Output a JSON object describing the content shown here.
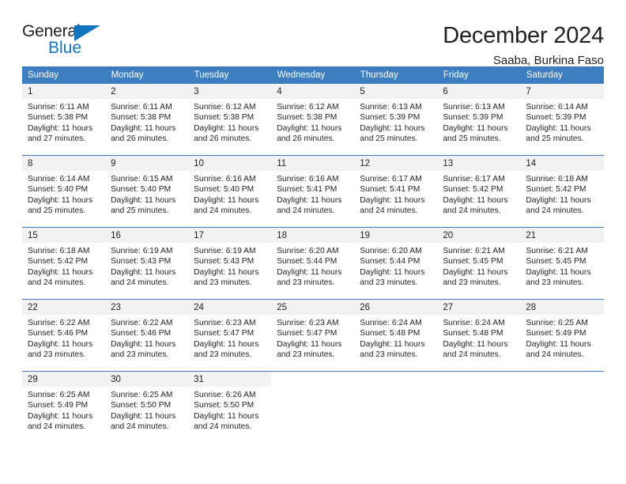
{
  "logo": {
    "word_top": "General",
    "word_bottom": "Blue",
    "triangle_color": "#1274bc",
    "blue_color": "#1274bc"
  },
  "header": {
    "title": "December 2024",
    "location": "Saaba, Burkina Faso"
  },
  "theme": {
    "header_blue": "#3c7ebf",
    "daynum_band": "#f2f2f2",
    "text": "#231f20"
  },
  "calendar": {
    "weekday_headers": [
      "Sunday",
      "Monday",
      "Tuesday",
      "Wednesday",
      "Thursday",
      "Friday",
      "Saturday"
    ],
    "labels": {
      "sunrise_prefix": "Sunrise:",
      "sunset_prefix": "Sunset:",
      "daylight_prefix": "Daylight:"
    },
    "weeks": [
      [
        {
          "day": "1",
          "sunrise": "Sunrise: 6:11 AM",
          "sunset": "Sunset: 5:38 PM",
          "daylight_line1": "Daylight: 11 hours",
          "daylight_line2": "and 27 minutes."
        },
        {
          "day": "2",
          "sunrise": "Sunrise: 6:11 AM",
          "sunset": "Sunset: 5:38 PM",
          "daylight_line1": "Daylight: 11 hours",
          "daylight_line2": "and 26 minutes."
        },
        {
          "day": "3",
          "sunrise": "Sunrise: 6:12 AM",
          "sunset": "Sunset: 5:38 PM",
          "daylight_line1": "Daylight: 11 hours",
          "daylight_line2": "and 26 minutes."
        },
        {
          "day": "4",
          "sunrise": "Sunrise: 6:12 AM",
          "sunset": "Sunset: 5:38 PM",
          "daylight_line1": "Daylight: 11 hours",
          "daylight_line2": "and 26 minutes."
        },
        {
          "day": "5",
          "sunrise": "Sunrise: 6:13 AM",
          "sunset": "Sunset: 5:39 PM",
          "daylight_line1": "Daylight: 11 hours",
          "daylight_line2": "and 25 minutes."
        },
        {
          "day": "6",
          "sunrise": "Sunrise: 6:13 AM",
          "sunset": "Sunset: 5:39 PM",
          "daylight_line1": "Daylight: 11 hours",
          "daylight_line2": "and 25 minutes."
        },
        {
          "day": "7",
          "sunrise": "Sunrise: 6:14 AM",
          "sunset": "Sunset: 5:39 PM",
          "daylight_line1": "Daylight: 11 hours",
          "daylight_line2": "and 25 minutes."
        }
      ],
      [
        {
          "day": "8",
          "sunrise": "Sunrise: 6:14 AM",
          "sunset": "Sunset: 5:40 PM",
          "daylight_line1": "Daylight: 11 hours",
          "daylight_line2": "and 25 minutes."
        },
        {
          "day": "9",
          "sunrise": "Sunrise: 6:15 AM",
          "sunset": "Sunset: 5:40 PM",
          "daylight_line1": "Daylight: 11 hours",
          "daylight_line2": "and 25 minutes."
        },
        {
          "day": "10",
          "sunrise": "Sunrise: 6:16 AM",
          "sunset": "Sunset: 5:40 PM",
          "daylight_line1": "Daylight: 11 hours",
          "daylight_line2": "and 24 minutes."
        },
        {
          "day": "11",
          "sunrise": "Sunrise: 6:16 AM",
          "sunset": "Sunset: 5:41 PM",
          "daylight_line1": "Daylight: 11 hours",
          "daylight_line2": "and 24 minutes."
        },
        {
          "day": "12",
          "sunrise": "Sunrise: 6:17 AM",
          "sunset": "Sunset: 5:41 PM",
          "daylight_line1": "Daylight: 11 hours",
          "daylight_line2": "and 24 minutes."
        },
        {
          "day": "13",
          "sunrise": "Sunrise: 6:17 AM",
          "sunset": "Sunset: 5:42 PM",
          "daylight_line1": "Daylight: 11 hours",
          "daylight_line2": "and 24 minutes."
        },
        {
          "day": "14",
          "sunrise": "Sunrise: 6:18 AM",
          "sunset": "Sunset: 5:42 PM",
          "daylight_line1": "Daylight: 11 hours",
          "daylight_line2": "and 24 minutes."
        }
      ],
      [
        {
          "day": "15",
          "sunrise": "Sunrise: 6:18 AM",
          "sunset": "Sunset: 5:42 PM",
          "daylight_line1": "Daylight: 11 hours",
          "daylight_line2": "and 24 minutes."
        },
        {
          "day": "16",
          "sunrise": "Sunrise: 6:19 AM",
          "sunset": "Sunset: 5:43 PM",
          "daylight_line1": "Daylight: 11 hours",
          "daylight_line2": "and 24 minutes."
        },
        {
          "day": "17",
          "sunrise": "Sunrise: 6:19 AM",
          "sunset": "Sunset: 5:43 PM",
          "daylight_line1": "Daylight: 11 hours",
          "daylight_line2": "and 23 minutes."
        },
        {
          "day": "18",
          "sunrise": "Sunrise: 6:20 AM",
          "sunset": "Sunset: 5:44 PM",
          "daylight_line1": "Daylight: 11 hours",
          "daylight_line2": "and 23 minutes."
        },
        {
          "day": "19",
          "sunrise": "Sunrise: 6:20 AM",
          "sunset": "Sunset: 5:44 PM",
          "daylight_line1": "Daylight: 11 hours",
          "daylight_line2": "and 23 minutes."
        },
        {
          "day": "20",
          "sunrise": "Sunrise: 6:21 AM",
          "sunset": "Sunset: 5:45 PM",
          "daylight_line1": "Daylight: 11 hours",
          "daylight_line2": "and 23 minutes."
        },
        {
          "day": "21",
          "sunrise": "Sunrise: 6:21 AM",
          "sunset": "Sunset: 5:45 PM",
          "daylight_line1": "Daylight: 11 hours",
          "daylight_line2": "and 23 minutes."
        }
      ],
      [
        {
          "day": "22",
          "sunrise": "Sunrise: 6:22 AM",
          "sunset": "Sunset: 5:46 PM",
          "daylight_line1": "Daylight: 11 hours",
          "daylight_line2": "and 23 minutes."
        },
        {
          "day": "23",
          "sunrise": "Sunrise: 6:22 AM",
          "sunset": "Sunset: 5:46 PM",
          "daylight_line1": "Daylight: 11 hours",
          "daylight_line2": "and 23 minutes."
        },
        {
          "day": "24",
          "sunrise": "Sunrise: 6:23 AM",
          "sunset": "Sunset: 5:47 PM",
          "daylight_line1": "Daylight: 11 hours",
          "daylight_line2": "and 23 minutes."
        },
        {
          "day": "25",
          "sunrise": "Sunrise: 6:23 AM",
          "sunset": "Sunset: 5:47 PM",
          "daylight_line1": "Daylight: 11 hours",
          "daylight_line2": "and 23 minutes."
        },
        {
          "day": "26",
          "sunrise": "Sunrise: 6:24 AM",
          "sunset": "Sunset: 5:48 PM",
          "daylight_line1": "Daylight: 11 hours",
          "daylight_line2": "and 23 minutes."
        },
        {
          "day": "27",
          "sunrise": "Sunrise: 6:24 AM",
          "sunset": "Sunset: 5:48 PM",
          "daylight_line1": "Daylight: 11 hours",
          "daylight_line2": "and 24 minutes."
        },
        {
          "day": "28",
          "sunrise": "Sunrise: 6:25 AM",
          "sunset": "Sunset: 5:49 PM",
          "daylight_line1": "Daylight: 11 hours",
          "daylight_line2": "and 24 minutes."
        }
      ],
      [
        {
          "day": "29",
          "sunrise": "Sunrise: 6:25 AM",
          "sunset": "Sunset: 5:49 PM",
          "daylight_line1": "Daylight: 11 hours",
          "daylight_line2": "and 24 minutes."
        },
        {
          "day": "30",
          "sunrise": "Sunrise: 6:25 AM",
          "sunset": "Sunset: 5:50 PM",
          "daylight_line1": "Daylight: 11 hours",
          "daylight_line2": "and 24 minutes."
        },
        {
          "day": "31",
          "sunrise": "Sunrise: 6:26 AM",
          "sunset": "Sunset: 5:50 PM",
          "daylight_line1": "Daylight: 11 hours",
          "daylight_line2": "and 24 minutes."
        },
        {
          "day": "",
          "sunrise": "",
          "sunset": "",
          "daylight_line1": "",
          "daylight_line2": ""
        },
        {
          "day": "",
          "sunrise": "",
          "sunset": "",
          "daylight_line1": "",
          "daylight_line2": ""
        },
        {
          "day": "",
          "sunrise": "",
          "sunset": "",
          "daylight_line1": "",
          "daylight_line2": ""
        },
        {
          "day": "",
          "sunrise": "",
          "sunset": "",
          "daylight_line1": "",
          "daylight_line2": ""
        }
      ]
    ]
  }
}
